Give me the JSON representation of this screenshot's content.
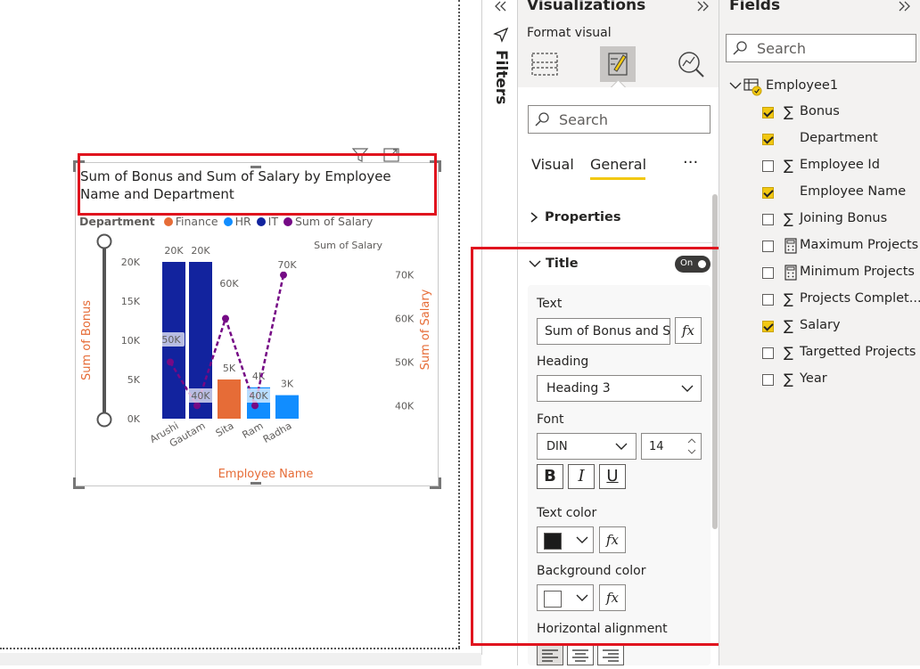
{
  "visual": {
    "title_line1": "Sum of Bonus and Sum of Salary by Employee",
    "title_line2": "Name and Department",
    "legend": {
      "label": "Department",
      "items": [
        {
          "name": "Finance",
          "color": "#e66c37"
        },
        {
          "name": "HR",
          "color": "#118dff"
        },
        {
          "name": "IT",
          "color": "#12239e"
        },
        {
          "name": "Sum of Salary",
          "color": "#750985"
        }
      ]
    },
    "y_left_label": "Sum of Bonus",
    "y_right_label": "Sum of Salary",
    "x_label": "Employee Name",
    "line_series_label": "Sum of Salary"
  },
  "chart_data": {
    "type": "bar",
    "categories": [
      "Arushi",
      "Gautam",
      "Sita",
      "Ram",
      "Radha"
    ],
    "series": [
      {
        "name": "Sum of Bonus",
        "values": [
          20000,
          20000,
          5000,
          4000,
          3000
        ],
        "colors": [
          "#12239e",
          "#12239e",
          "#e66c37",
          "#118dff",
          "#118dff"
        ],
        "labels": [
          "20K",
          "20K",
          "5K",
          "4K",
          "3K"
        ]
      },
      {
        "name": "Sum of Salary",
        "values": [
          50000,
          40000,
          60000,
          40000,
          70000
        ],
        "labels": [
          "50K",
          "40K",
          "60K",
          "40K",
          "70K"
        ],
        "color": "#750985"
      }
    ],
    "y_left_ticks": [
      "0K",
      "5K",
      "10K",
      "15K",
      "20K"
    ],
    "y_right_ticks": [
      "40K",
      "50K",
      "60K",
      "70K"
    ],
    "ylim_left": [
      0,
      20000
    ],
    "ylim_right": [
      37000,
      73000
    ]
  },
  "filters_label": "Filters",
  "viz_pane": {
    "title": "Visualizations",
    "subtitle": "Format visual",
    "search_placeholder": "Search",
    "tabs": [
      "Visual",
      "General"
    ],
    "more": "···",
    "properties": "Properties",
    "title_section": "Title",
    "toggle": "On",
    "text_label": "Text",
    "text_value": "Sum of Bonus and S",
    "heading_label": "Heading",
    "heading_value": "Heading 3",
    "font_label": "Font",
    "font_value": "DIN",
    "font_size": "14",
    "bold": "B",
    "italic": "I",
    "underline": "U",
    "text_color_label": "Text color",
    "text_color": "#1b1b1b",
    "bg_color_label": "Background color",
    "bg_color": "#ffffff",
    "halign_label": "Horizontal alignment",
    "fx": "fx"
  },
  "fields_pane": {
    "title": "Fields",
    "search_placeholder": "Search",
    "table": "Employee1",
    "items": [
      {
        "name": "Bonus",
        "checked": true,
        "sigma": "∑"
      },
      {
        "name": "Department",
        "checked": true,
        "sigma": ""
      },
      {
        "name": "Employee Id",
        "checked": false,
        "sigma": "∑"
      },
      {
        "name": "Employee Name",
        "checked": true,
        "sigma": ""
      },
      {
        "name": "Joining Bonus",
        "checked": false,
        "sigma": "∑"
      },
      {
        "name": "Maximum Projects",
        "checked": false,
        "sigma": "calc"
      },
      {
        "name": "Minimum Projects",
        "checked": false,
        "sigma": "calc"
      },
      {
        "name": "Projects Complet...",
        "checked": false,
        "sigma": "∑"
      },
      {
        "name": "Salary",
        "checked": true,
        "sigma": "∑"
      },
      {
        "name": "Targetted Projects",
        "checked": false,
        "sigma": "∑"
      },
      {
        "name": "Year",
        "checked": false,
        "sigma": "∑"
      }
    ]
  }
}
